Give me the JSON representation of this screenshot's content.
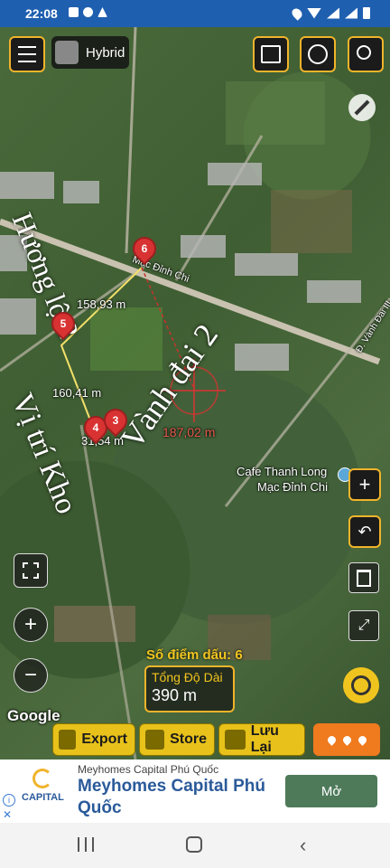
{
  "status_bar": {
    "time": "22:08",
    "battery_color": "#ffffff"
  },
  "toolbar": {
    "menu_icon": "menu-icon",
    "layer_label": "Hybrid"
  },
  "map_labels": {
    "street_main": "Mạc Đỉnh Chi",
    "street_right": "Đ. Vành Đai III",
    "cafe_line1": "Cafe Thanh Long",
    "cafe_line2": "Mạc Đỉnh Chi",
    "dist_1": "158,93 m",
    "dist_2": "160,41 m",
    "dist_3": "31,54 m",
    "dist_4": "187,02 m",
    "handwritten_1": "Vành đai 2",
    "handwritten_2": "Vị trí Kho",
    "handwritten_3": "Hương lộ 2",
    "google_logo": "Google"
  },
  "pins": [
    "6",
    "5",
    "4",
    "3"
  ],
  "measure": {
    "points_label": "Số điểm dấu:",
    "points_value": "6",
    "length_label": "Tổng Độ Dài",
    "length_value": "390 m"
  },
  "actions": {
    "export": "Export",
    "store": "Store",
    "save": "Lưu Lại"
  },
  "ad": {
    "brand": "Meyhomes Capital Phú Quốc",
    "headline": "Meyhomes Capital Phú Quốc",
    "logo_text": "CAPITAL",
    "cta": "Mở"
  },
  "colors": {
    "accent": "#f0b42b",
    "pin": "#d93232",
    "bar_yellow": "#e8c21a",
    "ad_button": "#4e7a5a"
  }
}
